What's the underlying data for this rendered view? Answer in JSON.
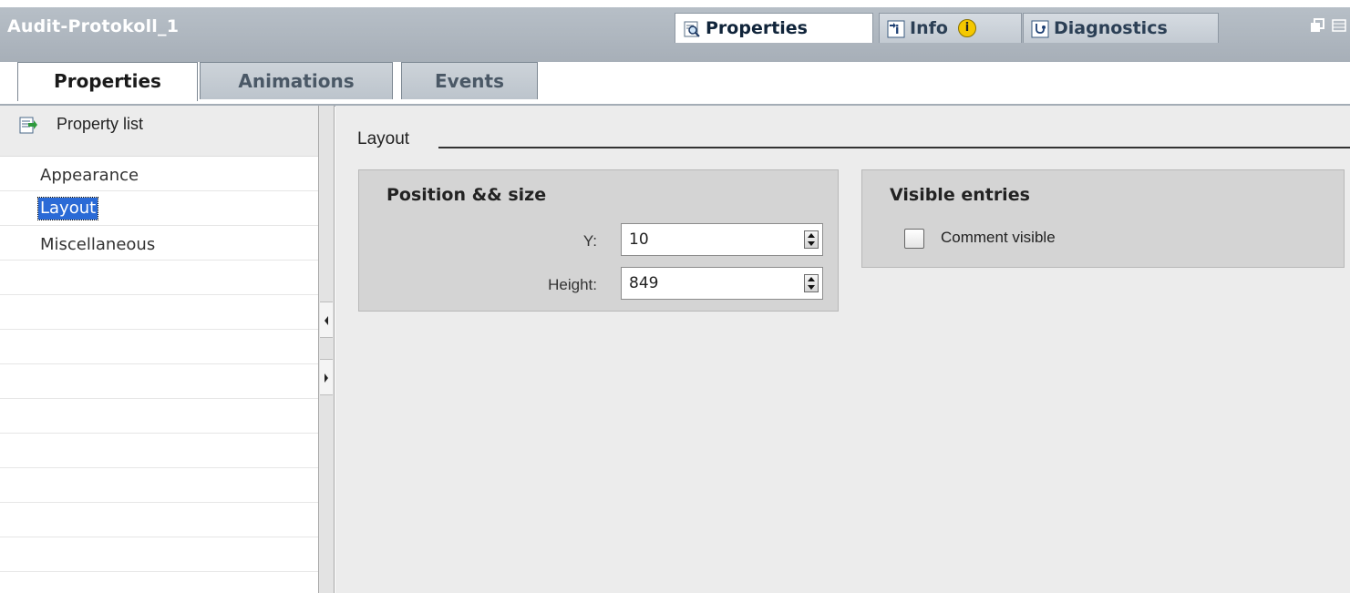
{
  "window": {
    "title": "Audit-Protokoll_1"
  },
  "inspector_tabs": [
    {
      "label": "Properties",
      "icon": "properties-magnifier-icon",
      "active": true
    },
    {
      "label": "Info",
      "icon": "info-arrow-icon",
      "badge": "i"
    },
    {
      "label": "Diagnostics",
      "icon": "diagnostics-icon"
    }
  ],
  "property_tabs": [
    {
      "label": "Properties",
      "active": true
    },
    {
      "label": "Animations"
    },
    {
      "label": "Events"
    }
  ],
  "nav": {
    "header": "Property list",
    "items": [
      {
        "label": "Appearance"
      },
      {
        "label": "Layout",
        "selected": true
      },
      {
        "label": "Miscellaneous"
      }
    ]
  },
  "content": {
    "section_title": "Layout",
    "position_group": {
      "title": "Position && size",
      "y_label": "Y:",
      "y_value": "10",
      "height_label": "Height:",
      "height_value": "849"
    },
    "visible_group": {
      "title": "Visible entries",
      "comment_label": "Comment visible",
      "comment_checked": false
    }
  },
  "colors": {
    "selection": "#2a6ad6",
    "titlebar": "#b0b8c1",
    "info_badge": "#f5c800"
  }
}
